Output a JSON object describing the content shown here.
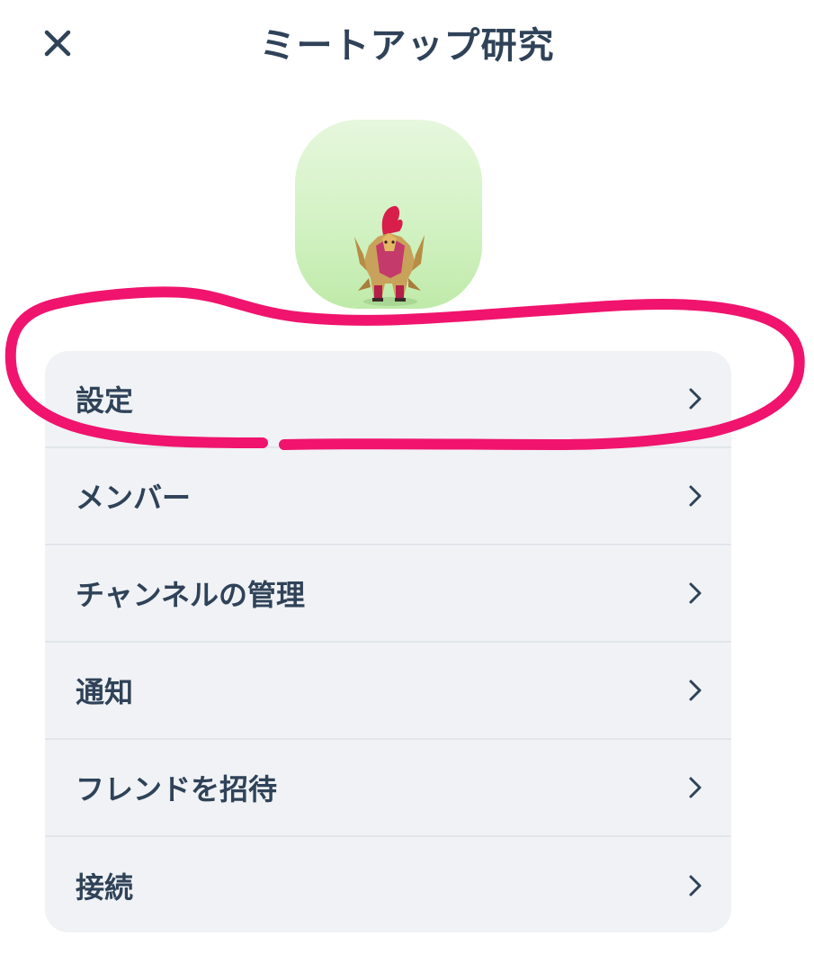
{
  "header": {
    "title": "ミートアップ研究"
  },
  "avatar": {
    "bg_top": "#e6f7dd",
    "bg_bottom": "#bfeaa9"
  },
  "menu": {
    "items": [
      {
        "label": "設定"
      },
      {
        "label": "メンバー"
      },
      {
        "label": "チャンネルの管理"
      },
      {
        "label": "通知"
      },
      {
        "label": "フレンドを招待"
      },
      {
        "label": "接続"
      }
    ]
  },
  "colors": {
    "text": "#2f4258",
    "card_bg": "#f0f2f5",
    "annotation": "#f0146e"
  }
}
